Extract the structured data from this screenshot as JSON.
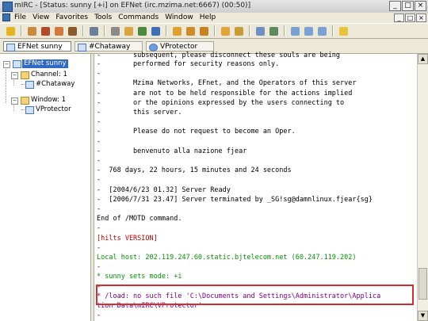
{
  "titlebar": {
    "title": "mIRC - [Status: sunny [+i] on EFNet (irc.mzima.net:6667) (00:50)]",
    "min": "_",
    "max": "□",
    "close": "×"
  },
  "menu": {
    "items": [
      "File",
      "View",
      "Favorites",
      "Tools",
      "Commands",
      "Window",
      "Help"
    ]
  },
  "tabs": [
    {
      "label": "EFNet sunny"
    },
    {
      "label": "#Chataway"
    },
    {
      "label": "VProtector"
    }
  ],
  "tree": {
    "root": "EFNet sunny",
    "channel_group": "Channel: 1",
    "channel": "#Chataway",
    "window_group": "Window: 1",
    "window": "VProtector",
    "expanders": [
      "−",
      "−",
      "−"
    ]
  },
  "chat": {
    "lines": [
      {
        "text": "-        performed for security reasons only.",
        "cls": ""
      },
      {
        "text": "-",
        "cls": ""
      },
      {
        "text": "-        Mzima Networks, EFnet, and the Operators of this server",
        "cls": ""
      },
      {
        "text": "-        are not to be held responsible for the actions implied",
        "cls": ""
      },
      {
        "text": "-        or the opinions expressed by the users connecting to",
        "cls": ""
      },
      {
        "text": "-        this server.",
        "cls": ""
      },
      {
        "text": "-",
        "cls": ""
      },
      {
        "text": "-        Please do not request to become an Oper.",
        "cls": ""
      },
      {
        "text": "-",
        "cls": ""
      },
      {
        "text": "-        benvenuto alla nazione fjear",
        "cls": ""
      },
      {
        "text": "-",
        "cls": ""
      },
      {
        "text": "-  768 days, 22 hours, 15 minutes and 24 seconds",
        "cls": ""
      },
      {
        "text": "-",
        "cls": ""
      },
      {
        "text": "-  [2004/6/23 01.32] Server Ready",
        "cls": ""
      },
      {
        "text": "-  [2006/7/31 23.47] Server terminated by _SG!sg@damnlinux.fjear{sg}",
        "cls": ""
      },
      {
        "text": "-",
        "cls": ""
      },
      {
        "text": "End of /MOTD command.",
        "cls": ""
      },
      {
        "text": "-",
        "cls": ""
      },
      {
        "text": "[hilts VERSION]",
        "cls": "red"
      },
      {
        "text": "-",
        "cls": ""
      },
      {
        "text": "Local host: 202.119.247.60.static.bjtelecom.net (60.247.119.202)",
        "cls": "green"
      },
      {
        "text": "-",
        "cls": ""
      },
      {
        "text": "* sunny sets mode: +i",
        "cls": "green"
      },
      {
        "text": "-",
        "cls": ""
      },
      {
        "text": "* /load: no such file 'C:\\Documents and Settings\\Administrator\\Applica",
        "cls": "purple"
      },
      {
        "text": "tion Data\\mIRC\\VProtector'",
        "cls": "purple"
      },
      {
        "text": "-",
        "cls": ""
      }
    ],
    "cut_top_line": "-        subsequent, please disconnect these souls are being"
  },
  "scrollbar": {
    "up": "▲",
    "down": "▼"
  }
}
